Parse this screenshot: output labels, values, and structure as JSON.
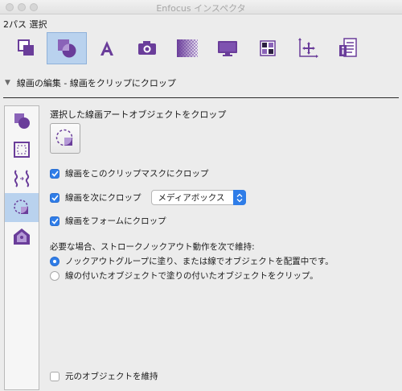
{
  "window": {
    "title": "Enfocus インスペクタ"
  },
  "selection_label": "2パス 選択",
  "toolbar": {
    "icons": [
      "shape-icon",
      "clip-icon",
      "text-icon",
      "image-icon",
      "transparency-icon",
      "monitor-icon",
      "pattern-icon",
      "position-icon",
      "document-info-icon"
    ],
    "active_index": 1
  },
  "section": {
    "title": "線画の編集 - 線画をクリップにクロップ"
  },
  "side_tabs": {
    "active_index": 3
  },
  "panel": {
    "heading": "選択した線画アートオブジェクトをクロップ",
    "options": [
      {
        "label": "線画をこのクリップマスクにクロップ",
        "checked": true
      },
      {
        "label": "線画を次にクロップ",
        "checked": true
      },
      {
        "label": "線画をフォームにクロップ",
        "checked": true
      }
    ],
    "crop_target": {
      "value": "メディアボックス"
    },
    "knockout_heading": "必要な場合、ストロークノックアウト動作を次で維持:",
    "radios": [
      {
        "label": "ノックアウトグループに塗り、または線でオブジェクトを配置中です。",
        "selected": true
      },
      {
        "label": "線の付いたオブジェクトで塗りの付いたオブジェクトをクリップ。",
        "selected": false
      }
    ],
    "keep_original": {
      "label": "元のオブジェクトを維持",
      "checked": false
    }
  },
  "colors": {
    "accent": "#2f7de8",
    "icon_purple": "#6a3d9a",
    "selected_bg": "#b9d2ee"
  }
}
